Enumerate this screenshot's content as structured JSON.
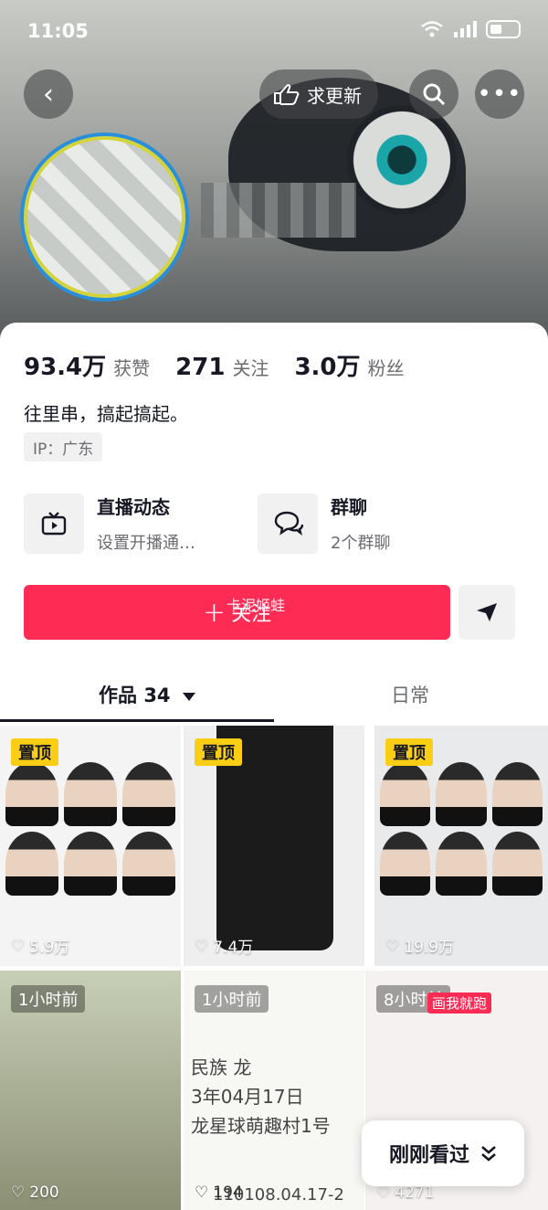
{
  "status": {
    "time": "11:05"
  },
  "header": {
    "update_label": "求更新"
  },
  "profile": {
    "likes_num": "93.4万",
    "likes_label": "获赞",
    "following_num": "271",
    "following_label": "关注",
    "followers_num": "3.0万",
    "followers_label": "粉丝",
    "bio": "往里串，搞起搞起。",
    "ip": "IP：广东"
  },
  "cards": [
    {
      "title": "直播动态",
      "sub": "设置开播通…",
      "icon": "tv-icon"
    },
    {
      "title": "群聊",
      "sub": "2个群聊",
      "icon": "chat-icon"
    }
  ],
  "follow": {
    "plus": "+",
    "label": "关注",
    "watermark": "卡泥姬蛙"
  },
  "tabs": {
    "works_label": "作品",
    "works_count": "34",
    "daily_label": "日常"
  },
  "videos": [
    {
      "tag": "置顶",
      "likes": "5.9万"
    },
    {
      "tag": "置顶",
      "likes": "7.4万"
    },
    {
      "tag": "置顶",
      "likes": "19.9万"
    },
    {
      "tag": "1小时前",
      "likes": "200"
    },
    {
      "tag": "1小时前",
      "likes": "194"
    },
    {
      "tag": "8小时前",
      "likes": "4271"
    }
  ],
  "overlay_texts": {
    "doc_line1": "民族 龙",
    "doc_line2": "3年04月17日",
    "doc_line3": "龙星球萌趣村1号",
    "doc_line4": "110108.04.17-2",
    "badge": "画我就跑"
  },
  "recent_label": "刚刚看过"
}
